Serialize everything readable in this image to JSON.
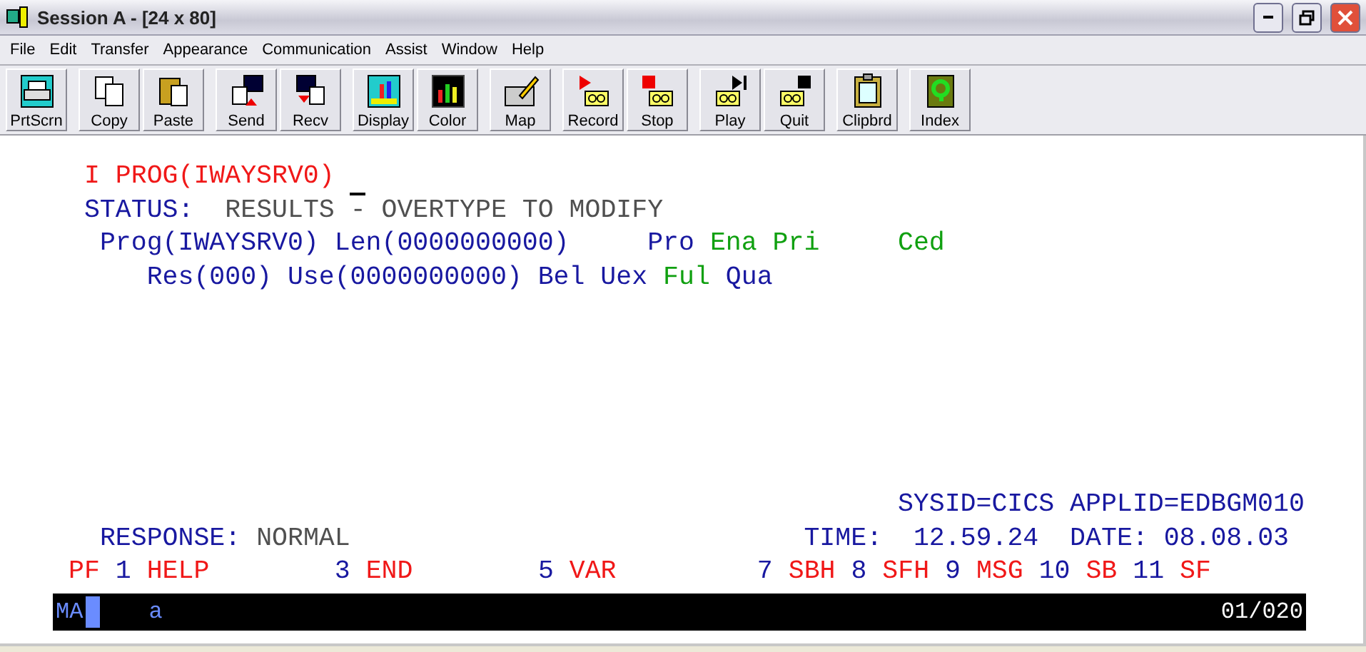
{
  "window": {
    "title": "Session A - [24 x 80]"
  },
  "menu": [
    "File",
    "Edit",
    "Transfer",
    "Appearance",
    "Communication",
    "Assist",
    "Window",
    "Help"
  ],
  "toolbar": [
    [
      "PrtScrn"
    ],
    [
      "Copy",
      "Paste"
    ],
    [
      "Send",
      "Recv"
    ],
    [
      "Display",
      "Color"
    ],
    [
      "Map"
    ],
    [
      "Record",
      "Stop"
    ],
    [
      "Play",
      "Quit"
    ],
    [
      "Clipbrd"
    ],
    [
      "Index"
    ]
  ],
  "screen": {
    "upper_lines": [
      [
        {
          "text": " I PROG(IWAYSRV0)",
          "color": "#f01818"
        }
      ],
      [
        {
          "text": " STATUS:",
          "color": "#1818a0"
        },
        {
          "text": "  RESULTS - OVERTYPE TO MODIFY",
          "color": "#505050"
        }
      ],
      [
        {
          "text": "  Prog(IWAYSRV0) Len(0000000000)     Pro",
          "color": "#1818a0"
        },
        {
          "text": " Ena Pri",
          "color": "#10a010"
        },
        {
          "text": "     Ced",
          "color": "#10a010"
        }
      ],
      [
        {
          "text": "     Res(000) Use(0000000000) Bel Uex",
          "color": "#1818a0"
        },
        {
          "text": " Ful",
          "color": "#10a010"
        },
        {
          "text": " Qua",
          "color": "#1818a0"
        }
      ]
    ],
    "lower_lines": [
      [
        {
          "text": "                                                     SYSID=CICS APPLID=EDBGM010",
          "color": "#1818a0"
        }
      ],
      [
        {
          "text": "  RESPONSE:",
          "color": "#1818a0"
        },
        {
          "text": " NORMAL",
          "color": "#505050"
        },
        {
          "text": "                             TIME:  12.59.24  DATE: 08.08.03",
          "color": "#1818a0"
        }
      ],
      [
        {
          "text": "PF",
          "color": "#f01818"
        },
        {
          "text": " 1",
          "color": "#1818a0"
        },
        {
          "text": " HELP",
          "color": "#f01818"
        },
        {
          "text": "        3",
          "color": "#1818a0"
        },
        {
          "text": " END",
          "color": "#f01818"
        },
        {
          "text": "        5",
          "color": "#1818a0"
        },
        {
          "text": " VAR",
          "color": "#f01818"
        },
        {
          "text": "         7",
          "color": "#1818a0"
        },
        {
          "text": " SBH",
          "color": "#f01818"
        },
        {
          "text": " 8",
          "color": "#1818a0"
        },
        {
          "text": " SFH",
          "color": "#f01818"
        },
        {
          "text": " 9",
          "color": "#1818a0"
        },
        {
          "text": " MSG",
          "color": "#f01818"
        },
        {
          "text": " 10",
          "color": "#1818a0"
        },
        {
          "text": " SB",
          "color": "#f01818"
        },
        {
          "text": " 11",
          "color": "#1818a0"
        },
        {
          "text": " SF",
          "color": "#f01818"
        }
      ]
    ]
  },
  "status_line": {
    "mode": "MA",
    "input": "a",
    "position": "01/020"
  }
}
